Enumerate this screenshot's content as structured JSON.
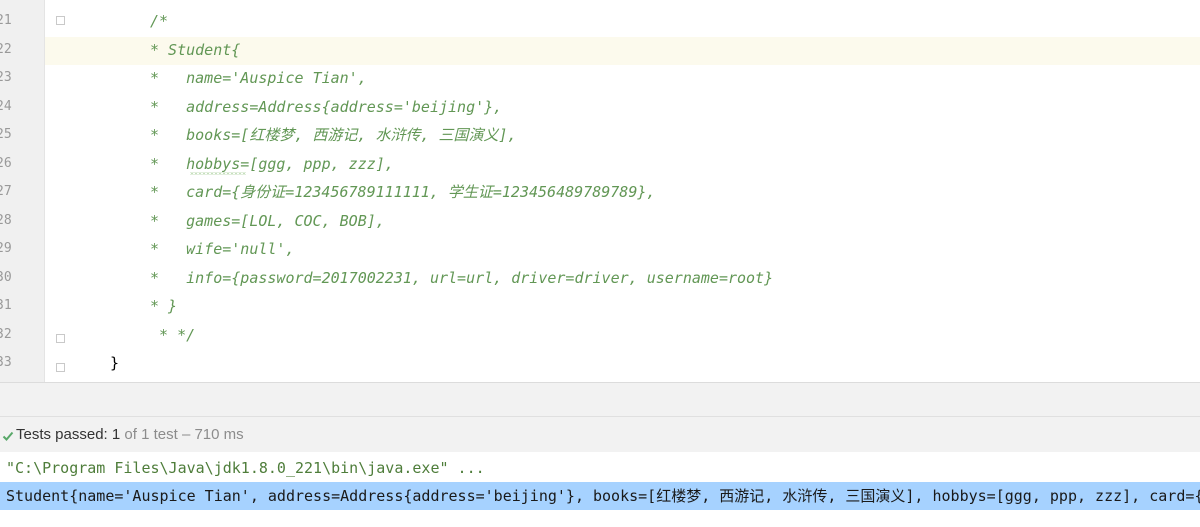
{
  "editor": {
    "line_numbers": [
      "21",
      "22",
      "23",
      "24",
      "25",
      "26",
      "27",
      "28",
      "29",
      "30",
      "31",
      "32",
      "33"
    ],
    "lines": [
      "/*",
      "* Student{",
      "*   name='Auspice Tian',",
      "*   address=Address{address='beijing'},",
      "*   books=[红楼梦, 西游记, 水浒传, 三国演义],",
      "*   hobbys=[ggg, ppp, zzz],",
      "*   card={身份证=123456789111111, 学生证=123456489789789},",
      "*   games=[LOL, COC, BOB],",
      "*   wife='null',",
      "*   info={password=2017002231, url=url, driver=driver, username=root}",
      "* }",
      " * */",
      "}"
    ]
  },
  "test_status": {
    "label": "Tests passed:",
    "count": "1",
    "detail": "of 1 test – 710 ms"
  },
  "console": {
    "command": "\"C:\\Program Files\\Java\\jdk1.8.0_221\\bin\\java.exe\" ...",
    "output": "Student{name='Auspice Tian', address=Address{address='beijing'}, books=[红楼梦, 西游记, 水浒传, 三国演义], hobbys=[ggg, ppp, zzz], card={身份证=123456789111111, 学生证=123456489789789}, games=[LOL, COC, BOB], wife='null', info={password=2017002231, url=url, driver=driver, username=root}}"
  },
  "colors": {
    "comment": "#629755",
    "current_line": "#fcfaed",
    "selection": "#a6d2ff",
    "pass_green": "#59a869"
  }
}
